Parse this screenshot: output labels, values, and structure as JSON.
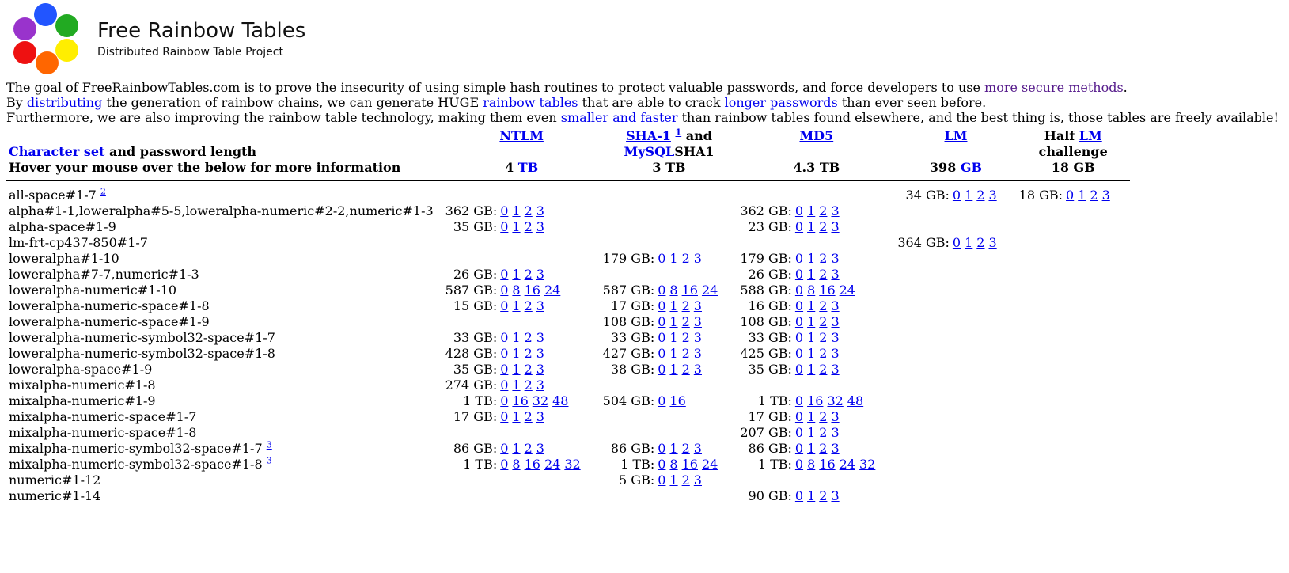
{
  "header": {
    "title": "Free Rainbow Tables",
    "subtitle": "Distributed Rainbow Table Project",
    "logo_colors": [
      "#2255ff",
      "#22aa22",
      "#ffee00",
      "#ff6600",
      "#ee1111",
      "#9933cc"
    ]
  },
  "intro": {
    "l1_a": "The goal of FreeRainbowTables.com is to prove the insecurity of using simple hash routines to protect valuable passwords, and force developers to use ",
    "l1_link": "more secure methods",
    "l1_b": ".",
    "l2_a": "By ",
    "l2_link1": "distributing",
    "l2_b": " the generation of rainbow chains, we can generate HUGE ",
    "l2_link2": "rainbow tables",
    "l2_c": " that are able to crack ",
    "l2_link3": "longer passwords",
    "l2_d": " than ever seen before.",
    "l3_a": "Furthermore, we are also improving the rainbow table technology, making them even ",
    "l3_link": "smaller and faster",
    "l3_b": " than rainbow tables found elsewhere, and the best thing is, those tables are freely available!"
  },
  "table": {
    "header": {
      "charset_link": "Character set",
      "charset_rest": " and password length",
      "hover_text": "Hover your mouse over the below for more information",
      "ntlm": "NTLM",
      "ntlm_size": "4 ",
      "ntlm_unit": "TB",
      "sha1": "SHA-1",
      "sha1_note": "1",
      "sha1_and": " and",
      "mysql": "MySQL",
      "mysql_rest": "SHA1",
      "sha1_size": "3 TB",
      "md5": "MD5",
      "md5_size": "4.3 TB",
      "lm": "LM",
      "lm_size": "398 ",
      "lm_unit": "GB",
      "half": "Half ",
      "half_lm": "LM",
      "challenge": "challenge",
      "half_size": "18 GB"
    },
    "rows": [
      {
        "name": "all-space#1-7",
        "note": "2",
        "cells": [
          null,
          null,
          null,
          {
            "size": "34 GB:",
            "links": [
              "0",
              "1",
              "2",
              "3"
            ]
          },
          {
            "size": "18 GB:",
            "links": [
              "0",
              "1",
              "2",
              "3"
            ]
          }
        ]
      },
      {
        "name": "alpha#1-1,loweralpha#5-5,loweralpha-numeric#2-2,numeric#1-3",
        "cells": [
          {
            "size": "362 GB:",
            "links": [
              "0",
              "1",
              "2",
              "3"
            ]
          },
          null,
          {
            "size": "362 GB:",
            "links": [
              "0",
              "1",
              "2",
              "3"
            ]
          },
          null,
          null
        ]
      },
      {
        "name": "alpha-space#1-9",
        "cells": [
          {
            "size": "35 GB:",
            "links": [
              "0",
              "1",
              "2",
              "3"
            ]
          },
          null,
          {
            "size": "23 GB:",
            "links": [
              "0",
              "1",
              "2",
              "3"
            ]
          },
          null,
          null
        ]
      },
      {
        "name": "lm-frt-cp437-850#1-7",
        "cells": [
          null,
          null,
          null,
          {
            "size": "364 GB:",
            "links": [
              "0",
              "1",
              "2",
              "3"
            ]
          },
          null
        ]
      },
      {
        "name": "loweralpha#1-10",
        "cells": [
          null,
          {
            "size": "179 GB:",
            "links": [
              "0",
              "1",
              "2",
              "3"
            ]
          },
          {
            "size": "179 GB:",
            "links": [
              "0",
              "1",
              "2",
              "3"
            ]
          },
          null,
          null
        ]
      },
      {
        "name": "loweralpha#7-7,numeric#1-3",
        "cells": [
          {
            "size": "26 GB:",
            "links": [
              "0",
              "1",
              "2",
              "3"
            ]
          },
          null,
          {
            "size": "26 GB:",
            "links": [
              "0",
              "1",
              "2",
              "3"
            ]
          },
          null,
          null
        ]
      },
      {
        "name": "loweralpha-numeric#1-10",
        "cells": [
          {
            "size": "587 GB:",
            "links": [
              "0",
              "8",
              "16",
              "24"
            ]
          },
          {
            "size": "587 GB:",
            "links": [
              "0",
              "8",
              "16",
              "24"
            ]
          },
          {
            "size": "588 GB:",
            "links": [
              "0",
              "8",
              "16",
              "24"
            ]
          },
          null,
          null
        ]
      },
      {
        "name": "loweralpha-numeric-space#1-8",
        "cells": [
          {
            "size": "15 GB:",
            "links": [
              "0",
              "1",
              "2",
              "3"
            ]
          },
          {
            "size": "17 GB:",
            "links": [
              "0",
              "1",
              "2",
              "3"
            ]
          },
          {
            "size": "16 GB:",
            "links": [
              "0",
              "1",
              "2",
              "3"
            ]
          },
          null,
          null
        ]
      },
      {
        "name": "loweralpha-numeric-space#1-9",
        "cells": [
          null,
          {
            "size": "108 GB:",
            "links": [
              "0",
              "1",
              "2",
              "3"
            ]
          },
          {
            "size": "108 GB:",
            "links": [
              "0",
              "1",
              "2",
              "3"
            ]
          },
          null,
          null
        ]
      },
      {
        "name": "loweralpha-numeric-symbol32-space#1-7",
        "cells": [
          {
            "size": "33 GB:",
            "links": [
              "0",
              "1",
              "2",
              "3"
            ]
          },
          {
            "size": "33 GB:",
            "links": [
              "0",
              "1",
              "2",
              "3"
            ]
          },
          {
            "size": "33 GB:",
            "links": [
              "0",
              "1",
              "2",
              "3"
            ]
          },
          null,
          null
        ]
      },
      {
        "name": "loweralpha-numeric-symbol32-space#1-8",
        "cells": [
          {
            "size": "428 GB:",
            "links": [
              "0",
              "1",
              "2",
              "3"
            ]
          },
          {
            "size": "427 GB:",
            "links": [
              "0",
              "1",
              "2",
              "3"
            ]
          },
          {
            "size": "425 GB:",
            "links": [
              "0",
              "1",
              "2",
              "3"
            ]
          },
          null,
          null
        ]
      },
      {
        "name": "loweralpha-space#1-9",
        "cells": [
          {
            "size": "35 GB:",
            "links": [
              "0",
              "1",
              "2",
              "3"
            ]
          },
          {
            "size": "38 GB:",
            "links": [
              "0",
              "1",
              "2",
              "3"
            ]
          },
          {
            "size": "35 GB:",
            "links": [
              "0",
              "1",
              "2",
              "3"
            ]
          },
          null,
          null
        ]
      },
      {
        "name": "mixalpha-numeric#1-8",
        "cells": [
          {
            "size": "274 GB:",
            "links": [
              "0",
              "1",
              "2",
              "3"
            ]
          },
          null,
          null,
          null,
          null
        ]
      },
      {
        "name": "mixalpha-numeric#1-9",
        "cells": [
          {
            "size": "1 TB:",
            "links": [
              "0",
              "16",
              "32",
              "48"
            ]
          },
          {
            "size": "504 GB:",
            "links": [
              "0",
              "16"
            ]
          },
          {
            "size": "1 TB:",
            "links": [
              "0",
              "16",
              "32",
              "48"
            ]
          },
          null,
          null
        ]
      },
      {
        "name": "mixalpha-numeric-space#1-7",
        "cells": [
          {
            "size": "17 GB:",
            "links": [
              "0",
              "1",
              "2",
              "3"
            ]
          },
          null,
          {
            "size": "17 GB:",
            "links": [
              "0",
              "1",
              "2",
              "3"
            ]
          },
          null,
          null
        ]
      },
      {
        "name": "mixalpha-numeric-space#1-8",
        "cells": [
          null,
          null,
          {
            "size": "207 GB:",
            "links": [
              "0",
              "1",
              "2",
              "3"
            ]
          },
          null,
          null
        ]
      },
      {
        "name": "mixalpha-numeric-symbol32-space#1-7",
        "note": "3",
        "cells": [
          {
            "size": "86 GB:",
            "links": [
              "0",
              "1",
              "2",
              "3"
            ]
          },
          {
            "size": "86 GB:",
            "links": [
              "0",
              "1",
              "2",
              "3"
            ]
          },
          {
            "size": "86 GB:",
            "links": [
              "0",
              "1",
              "2",
              "3"
            ]
          },
          null,
          null
        ]
      },
      {
        "name": "mixalpha-numeric-symbol32-space#1-8",
        "note": "3",
        "cells": [
          {
            "size": "1 TB:",
            "links": [
              "0",
              "8",
              "16",
              "24",
              "32"
            ]
          },
          {
            "size": "1 TB:",
            "links": [
              "0",
              "8",
              "16",
              "24"
            ]
          },
          {
            "size": "1 TB:",
            "links": [
              "0",
              "8",
              "16",
              "24",
              "32"
            ]
          },
          null,
          null
        ]
      },
      {
        "name": "numeric#1-12",
        "cells": [
          null,
          {
            "size": "5 GB:",
            "links": [
              "0",
              "1",
              "2",
              "3"
            ]
          },
          null,
          null,
          null
        ]
      },
      {
        "name": "numeric#1-14",
        "cells": [
          null,
          null,
          {
            "size": "90 GB:",
            "links": [
              "0",
              "1",
              "2",
              "3"
            ]
          },
          null,
          null
        ]
      }
    ]
  }
}
